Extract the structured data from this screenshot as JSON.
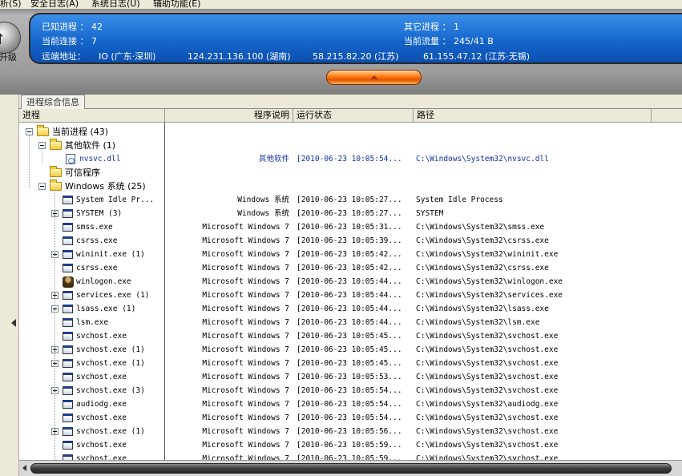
{
  "menu": [
    {
      "label": "析(S)"
    },
    {
      "label": "安全日志(A)"
    },
    {
      "label": "系统日志(U)"
    },
    {
      "label": "辅助功能(E)"
    }
  ],
  "header": {
    "upgrade_label": "升级",
    "known_process_label": "已知进程 ： 42",
    "other_process_label": "其它进程 ： 1",
    "current_conn_label": "当前连接 ： 7",
    "current_flow_label": "当前流量 ： 245/41 B",
    "remote_addr_label": "远端地址：",
    "remote_addrs": [
      "IO (广东·深圳)",
      "124.231.136.100 (湖南)",
      "58.215.82.20 (江苏)",
      "61.155.47.12 (江苏·无锡)"
    ]
  },
  "tab": {
    "label": "进程综合信息"
  },
  "columns": {
    "process": "进程",
    "desc": "程序说明",
    "status": "运行状态",
    "path": "路径"
  },
  "tree": [
    {
      "name": "当前进程 (43)",
      "desc": "",
      "status": "",
      "path": "",
      "indent": 0,
      "toggle": "minus",
      "icon": "folder"
    },
    {
      "name": "其他软件 (1)",
      "desc": "",
      "status": "",
      "path": "",
      "indent": 1,
      "toggle": "minus",
      "icon": "folder"
    },
    {
      "name": "nvsvc.dll",
      "desc": "其他软件",
      "status": "[2010-06-23 10:05:54...",
      "path": "C:\\Windows\\System32\\nvsvc.dll",
      "indent": 2,
      "toggle": "none",
      "icon": "dll",
      "blue": true
    },
    {
      "name": "可信程序",
      "desc": "",
      "status": "",
      "path": "",
      "indent": 1,
      "toggle": "none",
      "icon": "folder"
    },
    {
      "name": "Windows 系统 (25)",
      "desc": "",
      "status": "",
      "path": "",
      "indent": 1,
      "toggle": "minus",
      "icon": "folder"
    },
    {
      "name": "System Idle Pr...",
      "desc": "Windows 系统",
      "status": "[2010-06-23 10:05:27...",
      "path": "System Idle Process",
      "indent": 2,
      "toggle": "none",
      "icon": "proc"
    },
    {
      "name": "SYSTEM (3)",
      "desc": "Windows 系统",
      "status": "[2010-06-23 10:05:27...",
      "path": "SYSTEM",
      "indent": 2,
      "toggle": "plus",
      "icon": "proc"
    },
    {
      "name": "smss.exe",
      "desc": "Microsoft Windows 7",
      "status": "[2010-06-23 10:05:31...",
      "path": "C:\\Windows\\System32\\smss.exe",
      "indent": 2,
      "toggle": "none",
      "icon": "proc"
    },
    {
      "name": "csrss.exe",
      "desc": "Microsoft Windows 7",
      "status": "[2010-06-23 10:05:39...",
      "path": "C:\\Windows\\System32\\csrss.exe",
      "indent": 2,
      "toggle": "none",
      "icon": "proc"
    },
    {
      "name": "wininit.exe (1)",
      "desc": "Microsoft Windows 7",
      "status": "[2010-06-23 10:05:42...",
      "path": "C:\\Windows\\System32\\wininit.exe",
      "indent": 2,
      "toggle": "plus",
      "icon": "proc"
    },
    {
      "name": "csrss.exe",
      "desc": "Microsoft Windows 7",
      "status": "[2010-06-23 10:05:42...",
      "path": "C:\\Windows\\System32\\csrss.exe",
      "indent": 2,
      "toggle": "none",
      "icon": "proc"
    },
    {
      "name": "winlogon.exe",
      "desc": "Microsoft Windows 7",
      "status": "[2010-06-23 10:05:44...",
      "path": "C:\\Windows\\System32\\winlogon.exe",
      "indent": 2,
      "toggle": "none",
      "icon": "logon"
    },
    {
      "name": "services.exe (1)",
      "desc": "Microsoft Windows 7",
      "status": "[2010-06-23 10:05:44...",
      "path": "C:\\Windows\\System32\\services.exe",
      "indent": 2,
      "toggle": "plus",
      "icon": "proc"
    },
    {
      "name": "lsass.exe (1)",
      "desc": "Microsoft Windows 7",
      "status": "[2010-06-23 10:05:44...",
      "path": "C:\\Windows\\System32\\lsass.exe",
      "indent": 2,
      "toggle": "plus",
      "icon": "proc"
    },
    {
      "name": "lsm.exe",
      "desc": "Microsoft Windows 7",
      "status": "[2010-06-23 10:05:44...",
      "path": "C:\\Windows\\System32\\lsm.exe",
      "indent": 2,
      "toggle": "none",
      "icon": "proc"
    },
    {
      "name": "svchost.exe",
      "desc": "Microsoft Windows 7",
      "status": "[2010-06-23 10:05:45...",
      "path": "C:\\Windows\\System32\\svchost.exe",
      "indent": 2,
      "toggle": "none",
      "icon": "proc"
    },
    {
      "name": "svchost.exe (1)",
      "desc": "Microsoft Windows 7",
      "status": "[2010-06-23 10:05:45...",
      "path": "C:\\Windows\\System32\\svchost.exe",
      "indent": 2,
      "toggle": "plus",
      "icon": "proc"
    },
    {
      "name": "svchost.exe (1)",
      "desc": "Microsoft Windows 7",
      "status": "[2010-06-23 10:05:45...",
      "path": "C:\\Windows\\System32\\svchost.exe",
      "indent": 2,
      "toggle": "plus",
      "icon": "proc"
    },
    {
      "name": "svchost.exe",
      "desc": "Microsoft Windows 7",
      "status": "[2010-06-23 10:05:53...",
      "path": "C:\\Windows\\System32\\svchost.exe",
      "indent": 2,
      "toggle": "none",
      "icon": "proc"
    },
    {
      "name": "svchost.exe (3)",
      "desc": "Microsoft Windows 7",
      "status": "[2010-06-23 10:05:54...",
      "path": "C:\\Windows\\System32\\svchost.exe",
      "indent": 2,
      "toggle": "plus",
      "icon": "proc"
    },
    {
      "name": "audiodg.exe",
      "desc": "Microsoft Windows 7",
      "status": "[2010-06-23 10:05:54...",
      "path": "C:\\Windows\\System32\\audiodg.exe",
      "indent": 2,
      "toggle": "none",
      "icon": "proc"
    },
    {
      "name": "svchost.exe",
      "desc": "Microsoft Windows 7",
      "status": "[2010-06-23 10:05:54...",
      "path": "C:\\Windows\\System32\\svchost.exe",
      "indent": 2,
      "toggle": "none",
      "icon": "proc"
    },
    {
      "name": "svchost.exe (1)",
      "desc": "Microsoft Windows 7",
      "status": "[2010-06-23 10:05:56...",
      "path": "C:\\Windows\\System32\\svchost.exe",
      "indent": 2,
      "toggle": "plus",
      "icon": "proc"
    },
    {
      "name": "svchost.exe",
      "desc": "Microsoft Windows 7",
      "status": "[2010-06-23 10:05:59...",
      "path": "C:\\Windows\\System32\\svchost.exe",
      "indent": 2,
      "toggle": "none",
      "icon": "proc"
    },
    {
      "name": "svchost.exe",
      "desc": "Microsoft Windows 7",
      "status": "[2010-06-23 10:05:59...",
      "path": "C:\\Windows\\System32\\svchost.exe",
      "indent": 2,
      "toggle": "none",
      "icon": "proc"
    }
  ]
}
